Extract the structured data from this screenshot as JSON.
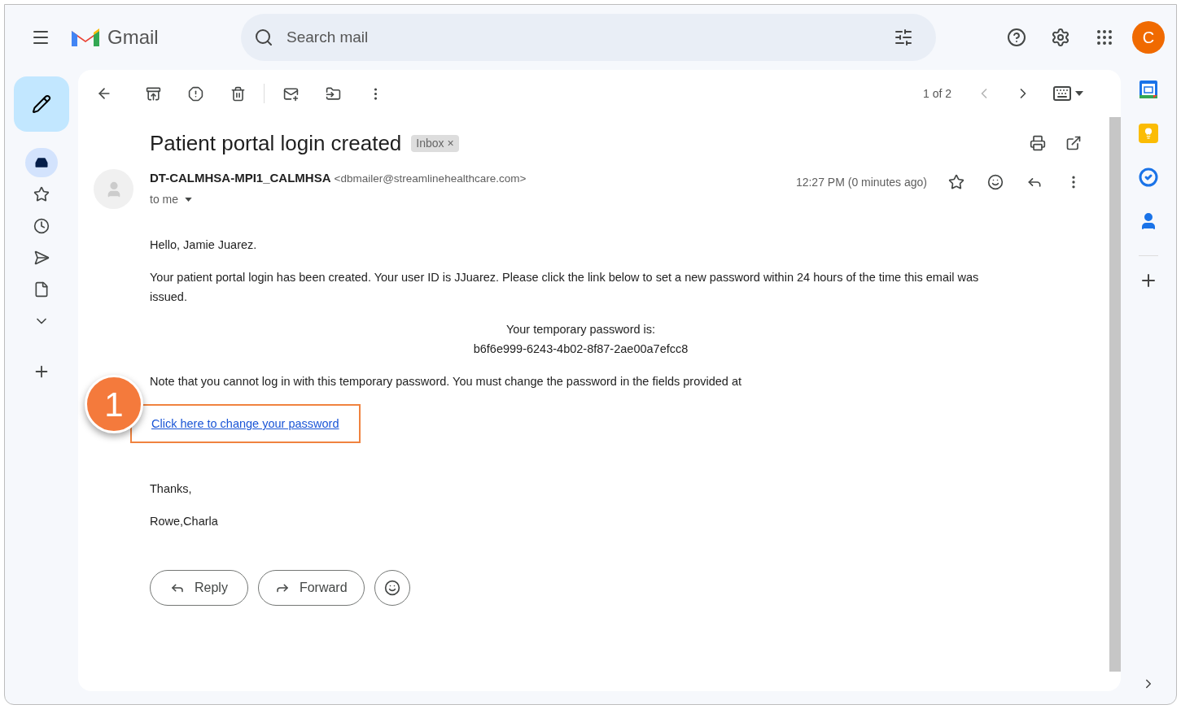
{
  "app": {
    "logo": "Gmail",
    "avatar": "C"
  },
  "search": {
    "placeholder": "Search mail"
  },
  "sidebar": {
    "items": [
      {
        "selected": true
      },
      {
        "selected": false
      },
      {
        "selected": false
      },
      {
        "selected": false
      },
      {
        "selected": false
      },
      {
        "selected": false
      }
    ]
  },
  "pager": {
    "text": "1 of 2"
  },
  "message": {
    "subject": "Patient portal login created",
    "label": "Inbox",
    "label_close": "×",
    "sender_name": "DT-CALMHSA-MPI1_CALMHSA",
    "sender_email": "<dbmailer@streamlinehealthcare.com>",
    "recipient": "to me",
    "time": "12:27 PM (0 minutes ago)",
    "body": [
      {
        "kind": "para",
        "text": "Hello, Jamie Juarez."
      },
      {
        "kind": "para",
        "text": "Your patient portal login has been created. Your user ID is JJuarez. Please click the link below to set a new password within 24 hours of the time this email was issued."
      },
      {
        "kind": "center",
        "text": "Your temporary password is:"
      },
      {
        "kind": "center",
        "text": "b6f6e999-6243-4b02-8f87-2ae00a7efcc8"
      },
      {
        "kind": "para",
        "text": "Note that you cannot log in with this temporary password. You must change the password in the fields provided at"
      },
      {
        "kind": "link",
        "text": "Click here to change your password",
        "callout": "1"
      },
      {
        "kind": "gap"
      },
      {
        "kind": "para",
        "text": "Thanks,"
      },
      {
        "kind": "para",
        "text": "Rowe,Charla"
      }
    ]
  },
  "actions": [
    {
      "kind": "reply",
      "label": "Reply"
    },
    {
      "kind": "forward",
      "label": "Forward"
    },
    {
      "kind": "emoji"
    }
  ]
}
